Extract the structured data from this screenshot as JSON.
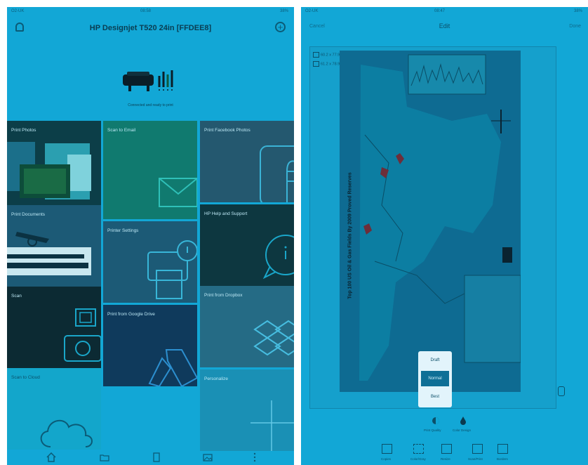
{
  "left_screen": {
    "status_bar": {
      "carrier": "O2-UK",
      "time": "08:58",
      "battery": "38%"
    },
    "printer_name": "HP Designjet T520 24in [FFDEE8]",
    "printer_status": "Connected and ready to print",
    "tiles": {
      "print_photos": "Print Photos",
      "scan_to_email": "Scan to Email",
      "print_facebook_photos": "Print Facebook Photos",
      "print_documents": "Print Documents",
      "hp_help_and_support": "HP Help and Support",
      "printer_settings": "Printer Settings",
      "scan": "Scan",
      "print_from_dropbox": "Print from Dropbox",
      "print_from_google_drive": "Print from Google Drive",
      "scan_to_cloud": "Scan to Cloud",
      "personalize": "Personalize"
    },
    "nav_icons": [
      "home-icon",
      "folder-icon",
      "document-icon",
      "photo-icon",
      "more-icon"
    ]
  },
  "right_screen": {
    "status_bar": {
      "carrier": "O2-UK",
      "time": "08:47",
      "battery": "38%"
    },
    "cancel_label": "Cancel",
    "title": "Edit",
    "done_label": "Done",
    "paper_sizes": [
      "60.2 x 77.9 cm",
      "61.2 x 78.9 cm"
    ],
    "map_title": "Top 100 US Oil & Gas Fields By 2009 Proved Reserves",
    "quality_options": [
      "Draft",
      "Normal",
      "Best"
    ],
    "selected_quality": "Normal",
    "mode_labels": {
      "print_quality": "Print Quality",
      "color_design": "Color Design"
    },
    "toolbar": [
      "Copies",
      "Color/Gray",
      "Resize",
      "Scan/Print",
      "Borders"
    ]
  },
  "colors": {
    "screen_bg": "#12a7d6",
    "tile_dark": "#0c3e48",
    "tile_green": "#107a6f",
    "tile_navy": "#0f3a5c",
    "tile_mid": "#1c5a76"
  }
}
